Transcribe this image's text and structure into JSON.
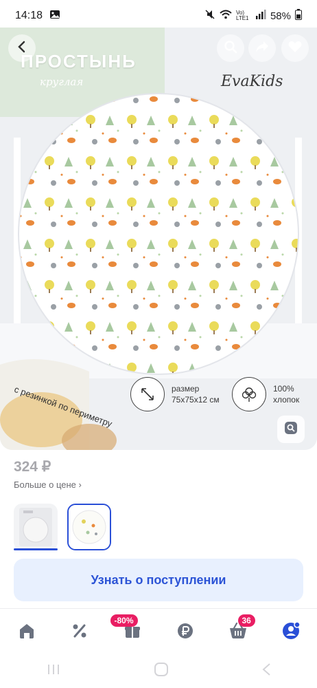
{
  "status_bar": {
    "time": "14:18",
    "battery": "58%",
    "network_label": "Vo) LTE1"
  },
  "hero": {
    "title": "ПРОСТЫНЬ",
    "subtitle": "круглая",
    "brand": "EvaKids",
    "ribbon_text": "с резинкой по периметру",
    "size_label": "размер",
    "size_value": "75x75x12 см",
    "cotton_value": "100%",
    "cotton_label": "хлопок"
  },
  "product": {
    "price": "324 ₽",
    "price_more": "Больше о цене ›"
  },
  "actions": {
    "notify_label": "Узнать о поступлении"
  },
  "bottom_nav": {
    "items": [
      {
        "name": "home",
        "icon": "home-icon"
      },
      {
        "name": "discounts",
        "icon": "percent-icon"
      },
      {
        "name": "sale",
        "icon": "gift-icon",
        "badge": "-80%"
      },
      {
        "name": "finance",
        "icon": "ruble-icon"
      },
      {
        "name": "cart",
        "icon": "cart-icon",
        "badge": "36"
      },
      {
        "name": "profile",
        "icon": "profile-icon"
      }
    ]
  },
  "colors": {
    "accent": "#2a4fd7",
    "badge": "#e91e63",
    "button_bg": "#e8f0fe"
  }
}
